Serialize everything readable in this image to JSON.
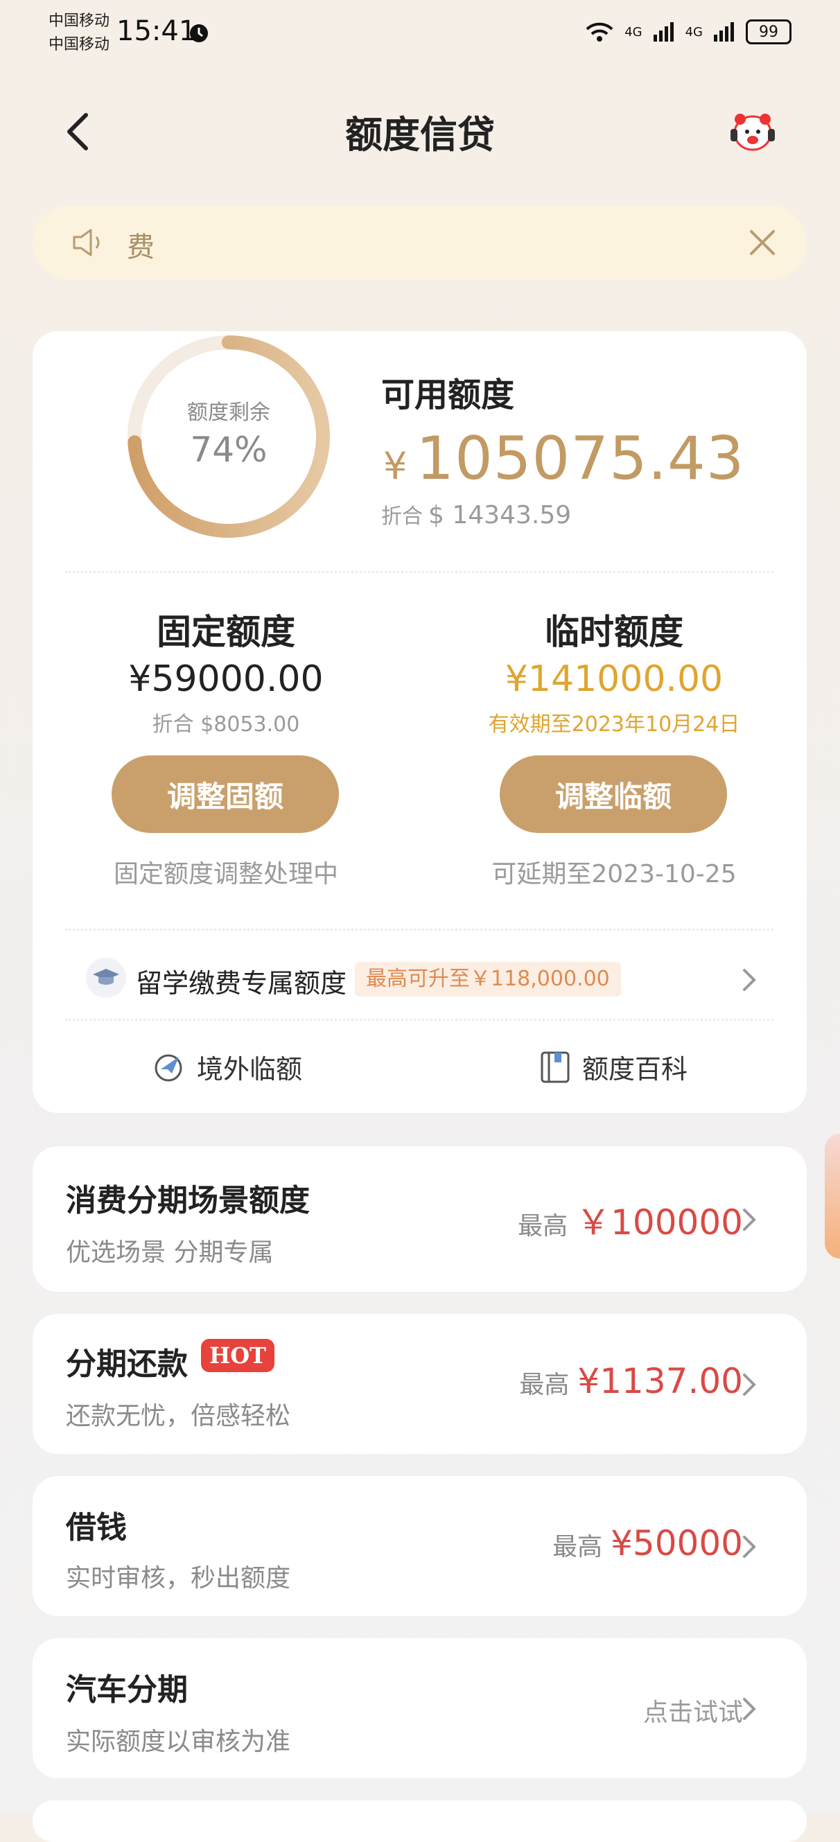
{
  "status_bar": {
    "carrier_1": "中国移动",
    "carrier_2": "中国移动",
    "time": "15:41",
    "net_1": "4G",
    "net_2": "4G",
    "battery": "99"
  },
  "nav": {
    "title": "额度信贷"
  },
  "notice": {
    "text": "费"
  },
  "credit": {
    "ring_label": "额度剩余",
    "ring_percent": "74%",
    "ring_fraction": 0.74,
    "available_label": "可用额度",
    "available_currency": "¥",
    "available_amount": "105075.43",
    "available_usd_label": "折合",
    "available_usd": "$ 14343.59",
    "fixed": {
      "title": "固定额度",
      "amount": "¥59000.00",
      "sub": "折合 $8053.00",
      "button": "调整固额",
      "note": "固定额度调整处理中"
    },
    "temp": {
      "title": "临时额度",
      "amount": "¥141000.00",
      "sub": "有效期至2023年10月24日",
      "button": "调整临额",
      "note": "可延期至2023-10-25"
    },
    "study": {
      "label": "留学缴费专属额度",
      "badge": "最高可升至￥118,000.00"
    },
    "tools": [
      {
        "label": "境外临额",
        "icon": "plane-clock-icon"
      },
      {
        "label": "额度百科",
        "icon": "book-icon"
      }
    ]
  },
  "products": [
    {
      "title": "消费分期场景额度",
      "sub": "优选场景 分期专属",
      "prefix": "最高",
      "value": "￥100000"
    },
    {
      "title": "分期还款",
      "badge": "HOT",
      "sub": "还款无忧，倍感轻松",
      "prefix": "最高",
      "value": "¥1137.00"
    },
    {
      "title": "借钱",
      "sub": "实时审核，秒出额度",
      "prefix": "最高",
      "value": "¥50000"
    },
    {
      "title": "汽车分期",
      "sub": "实际额度以审核为准",
      "action": "点击试试"
    }
  ],
  "colors": {
    "accent": "#c9a06b",
    "gold": "#e0a530",
    "red": "#d94a45"
  }
}
